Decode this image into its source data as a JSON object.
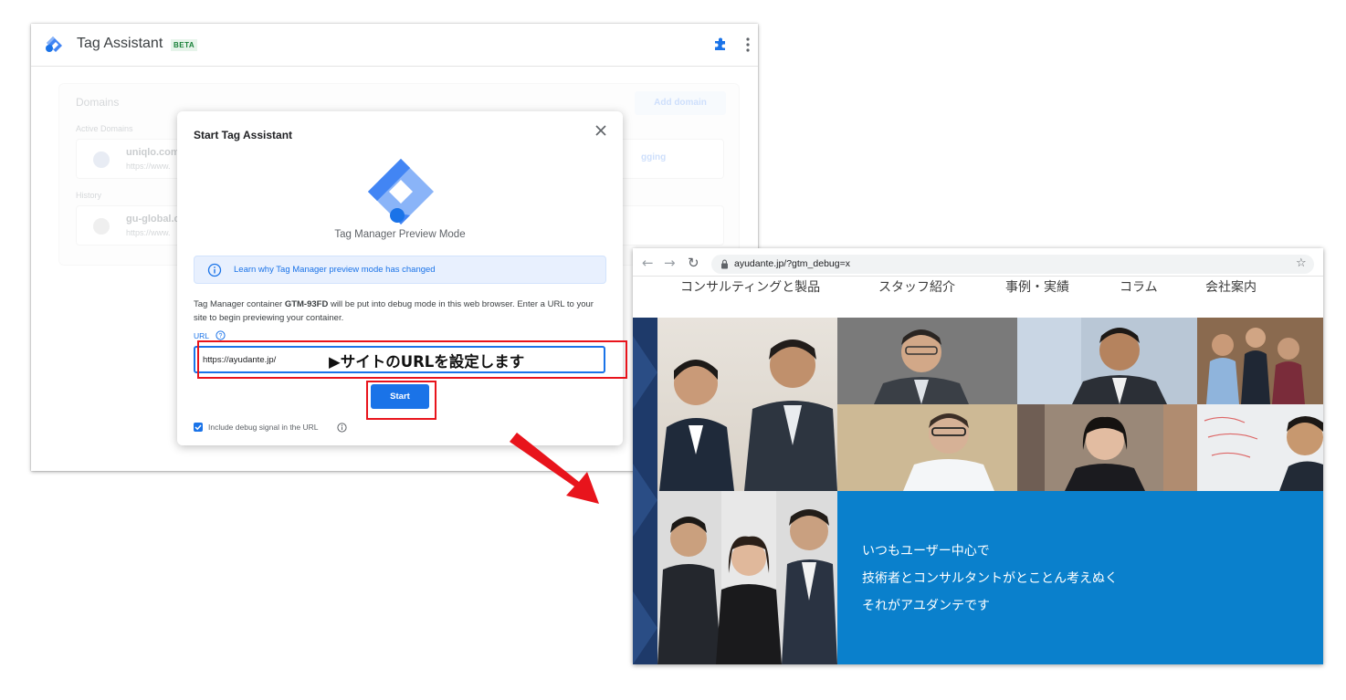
{
  "tag_assistant": {
    "title": "Tag Assistant",
    "badge": "BETA",
    "background": {
      "domains_heading": "Domains",
      "add_domain": "Add domain",
      "active_domains": "Active Domains",
      "row1_name": "uniqlo.com",
      "row1_url": "https://www.",
      "row1_action": "gging",
      "history": "History",
      "row2_name": "gu-global.c",
      "row2_url": "https://www."
    }
  },
  "dialog": {
    "title": "Start Tag Assistant",
    "subtitle": "Tag Manager Preview Mode",
    "info_text": "Learn why Tag Manager preview mode has changed",
    "desc_prefix": "Tag Manager container ",
    "container_id": "GTM-93FD",
    "desc_suffix": " will be put into debug mode in this web browser. Enter a URL to your site to begin previewing your container.",
    "url_label": "URL",
    "url_value": "https://ayudante.jp/",
    "start_label": "Start",
    "checkbox_label": "Include debug signal in the URL",
    "checkbox_checked": true
  },
  "annotation": {
    "url_callout": "▶サイトのURLを設定します",
    "highlight_color": "#e8141c"
  },
  "browser": {
    "url": "ayudante.jp/?gtm_debug=x",
    "nav": [
      "コンサルティングと製品",
      "スタッフ紹介",
      "事例・実績",
      "コラム",
      "会社案内"
    ],
    "catchcopy": [
      "いつもユーザー中心で",
      "技術者とコンサルタントがとことん考えぬく",
      "それがアユダンテです"
    ]
  },
  "colors": {
    "accent": "#1a73e8",
    "hero_blue": "#0a80cc",
    "annotation_red": "#e8141c"
  },
  "icons": [
    "tag-assistant-logo-icon",
    "extension-icon",
    "more-vert-icon",
    "close-icon",
    "gtm-logo-icon",
    "info-icon",
    "help-icon",
    "checkbox-icon",
    "back-icon",
    "forward-icon",
    "reload-icon",
    "lock-icon",
    "star-icon"
  ]
}
